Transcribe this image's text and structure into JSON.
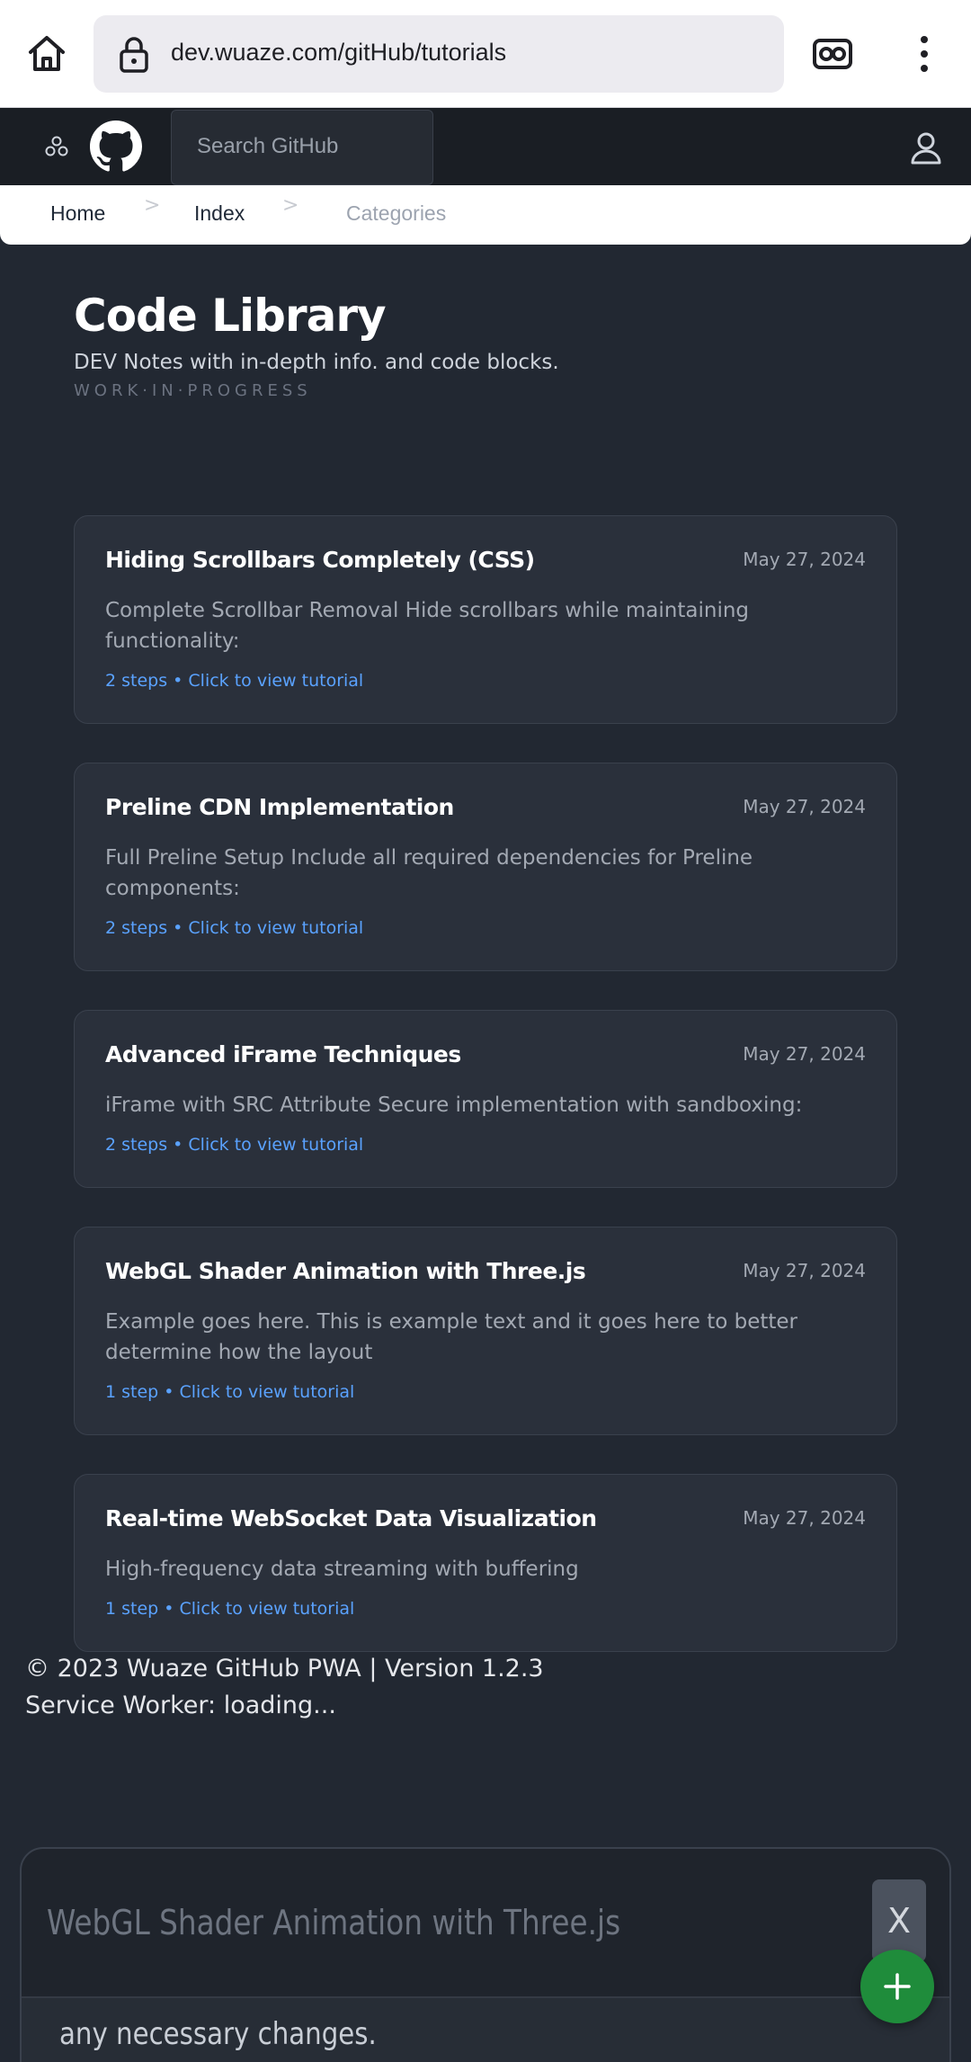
{
  "browser": {
    "url": "dev.wuaze.com/gitHub/tutorials"
  },
  "header": {
    "search_placeholder": "Search GitHub"
  },
  "breadcrumb": {
    "items": [
      "Home",
      "Index",
      "Categories"
    ],
    "separator": ">"
  },
  "hero": {
    "title": "Code Library",
    "subtitle": "DEV Notes with in-depth info. and code blocks.",
    "tagline": "WORK·IN·PROGRESS"
  },
  "cards": [
    {
      "title": "Hiding Scrollbars Completely (CSS)",
      "date": "May 27, 2024",
      "description": "Complete Scrollbar Removal Hide scrollbars while maintaining functionality:",
      "meta": "2 steps • Click to view tutorial"
    },
    {
      "title": "Preline CDN Implementation",
      "date": "May 27, 2024",
      "description": "Full Preline Setup Include all required dependencies for Preline components:",
      "meta": "2 steps • Click to view tutorial"
    },
    {
      "title": "Advanced iFrame Techniques",
      "date": "May 27, 2024",
      "description": "iFrame with SRC Attribute Secure implementation with sandboxing:",
      "meta": "2 steps • Click to view tutorial"
    },
    {
      "title": "WebGL Shader Animation with Three.js",
      "date": "May 27, 2024",
      "description": "Example goes here. This is example text and it goes here to better determine how the layout",
      "meta": "1 step • Click to view tutorial"
    },
    {
      "title": "Real-time WebSocket Data Visualization",
      "date": "May 27, 2024",
      "description": "High-frequency data streaming with buffering",
      "meta": "1 step • Click to view tutorial"
    }
  ],
  "footer": {
    "copyright": "© 2023 Wuaze GitHub PWA | Version 1.2.3",
    "sw_status": "Service Worker: loading..."
  },
  "sheet": {
    "title": "WebGL Shader Animation with Three.js",
    "close_label": "X",
    "body_text": "any necessary changes."
  },
  "colors": {
    "page_bg": "#222832",
    "card_bg": "#2a303b",
    "link": "#5aa2ff",
    "fab": "#1f8c3b"
  }
}
